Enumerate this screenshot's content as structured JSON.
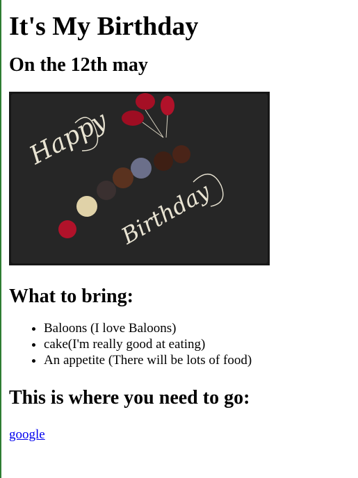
{
  "page": {
    "title": "It's My Birthday",
    "date_heading": "On the 12th may",
    "image_alt": "Happy Birthday cake plate",
    "image_text_1": "Happy",
    "image_text_2": "Birthday",
    "bring_heading": "What to bring:",
    "bring_items": [
      "Baloons (I love Baloons)",
      "cake(I'm really good at eating)",
      "An appetite (There will be lots of food)"
    ],
    "where_heading": "This is where you need to go:",
    "link_text": "google"
  },
  "colors": {
    "link": "#0000ee",
    "left_border": "#2e7d32",
    "plate": "#1a1a1a",
    "balloon": "#b1122a"
  }
}
